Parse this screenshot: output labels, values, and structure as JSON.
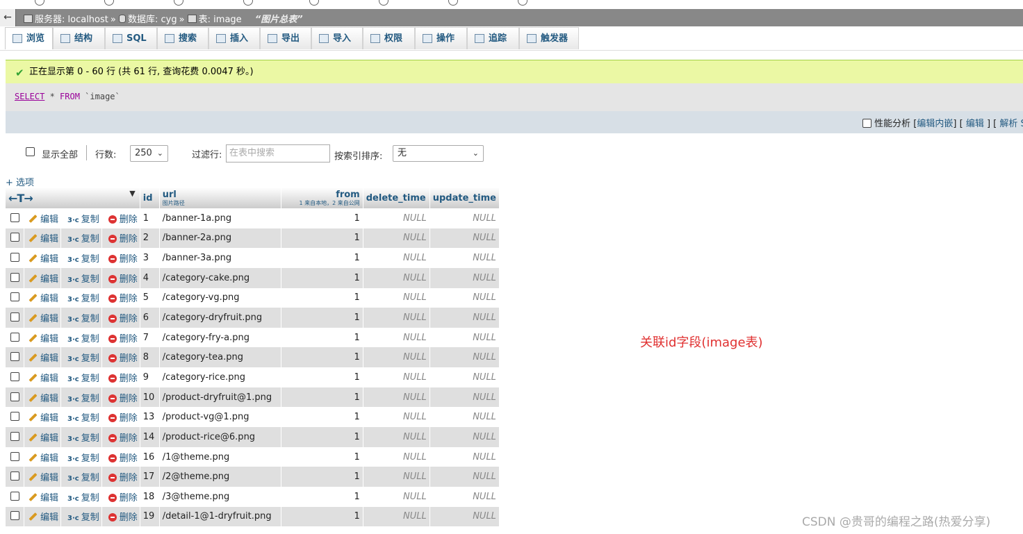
{
  "breadcrumb": {
    "server": "服务器: localhost",
    "database": "数据库: cyg",
    "table": "表: image",
    "comment": "“图片总表”"
  },
  "tabs": [
    {
      "label": "浏览",
      "icon": "browse-icon",
      "active": true
    },
    {
      "label": "结构",
      "icon": "structure-icon"
    },
    {
      "label": "SQL",
      "icon": "sql-icon"
    },
    {
      "label": "搜索",
      "icon": "search-icon"
    },
    {
      "label": "插入",
      "icon": "insert-icon"
    },
    {
      "label": "导出",
      "icon": "export-icon"
    },
    {
      "label": "导入",
      "icon": "import-icon"
    },
    {
      "label": "权限",
      "icon": "privileges-icon"
    },
    {
      "label": "操作",
      "icon": "operations-icon"
    },
    {
      "label": "追踪",
      "icon": "tracking-icon"
    },
    {
      "label": "触发器",
      "icon": "triggers-icon"
    }
  ],
  "notice": "正在显示第 0 - 60 行 (共 61 行, 查询花费 0.0047 秒。)",
  "sql": {
    "select": "SELECT",
    "star": " * ",
    "from": "FROM",
    "table": " `image`"
  },
  "profiling": {
    "label": "性能分析",
    "edit_inline": "编辑内嵌",
    "edit": "编辑",
    "parse": "解析 S"
  },
  "controls": {
    "show_all": "显示全部",
    "rows_label": "行数:",
    "rows_value": "250",
    "filter_label": "过滤行:",
    "filter_placeholder": "在表中搜索",
    "sort_label": "按索引排序:",
    "sort_value": "无"
  },
  "options_link": "+ 选项",
  "columns": {
    "arrows": "←T→",
    "id": "id",
    "url": "url",
    "url_comment": "图片路径",
    "from": "from",
    "from_comment": "1 来自本地，2 来自公网",
    "delete_time": "delete_time",
    "update_time": "update_time"
  },
  "actions": {
    "edit": "编辑",
    "copy": "复制",
    "delete": "删除"
  },
  "rows": [
    {
      "id": "1",
      "url": "/banner-1a.png",
      "from": "1",
      "delete_time": "NULL",
      "update_time": "NULL"
    },
    {
      "id": "2",
      "url": "/banner-2a.png",
      "from": "1",
      "delete_time": "NULL",
      "update_time": "NULL"
    },
    {
      "id": "3",
      "url": "/banner-3a.png",
      "from": "1",
      "delete_time": "NULL",
      "update_time": "NULL"
    },
    {
      "id": "4",
      "url": "/category-cake.png",
      "from": "1",
      "delete_time": "NULL",
      "update_time": "NULL"
    },
    {
      "id": "5",
      "url": "/category-vg.png",
      "from": "1",
      "delete_time": "NULL",
      "update_time": "NULL"
    },
    {
      "id": "6",
      "url": "/category-dryfruit.png",
      "from": "1",
      "delete_time": "NULL",
      "update_time": "NULL"
    },
    {
      "id": "7",
      "url": "/category-fry-a.png",
      "from": "1",
      "delete_time": "NULL",
      "update_time": "NULL"
    },
    {
      "id": "8",
      "url": "/category-tea.png",
      "from": "1",
      "delete_time": "NULL",
      "update_time": "NULL"
    },
    {
      "id": "9",
      "url": "/category-rice.png",
      "from": "1",
      "delete_time": "NULL",
      "update_time": "NULL"
    },
    {
      "id": "10",
      "url": "/product-dryfruit@1.png",
      "from": "1",
      "delete_time": "NULL",
      "update_time": "NULL"
    },
    {
      "id": "13",
      "url": "/product-vg@1.png",
      "from": "1",
      "delete_time": "NULL",
      "update_time": "NULL"
    },
    {
      "id": "14",
      "url": "/product-rice@6.png",
      "from": "1",
      "delete_time": "NULL",
      "update_time": "NULL"
    },
    {
      "id": "16",
      "url": "/1@theme.png",
      "from": "1",
      "delete_time": "NULL",
      "update_time": "NULL"
    },
    {
      "id": "17",
      "url": "/2@theme.png",
      "from": "1",
      "delete_time": "NULL",
      "update_time": "NULL"
    },
    {
      "id": "18",
      "url": "/3@theme.png",
      "from": "1",
      "delete_time": "NULL",
      "update_time": "NULL"
    },
    {
      "id": "19",
      "url": "/detail-1@1-dryfruit.png",
      "from": "1",
      "delete_time": "NULL",
      "update_time": "NULL"
    }
  ],
  "annotation": "关联id字段(image表)",
  "watermark": "CSDN @贵哥的编程之路(热爱分享)",
  "colors": {
    "link": "#235a81",
    "notice_bg": "#ebf8a4",
    "annotation": "#e03030",
    "delete_icon": "#dd3333"
  }
}
